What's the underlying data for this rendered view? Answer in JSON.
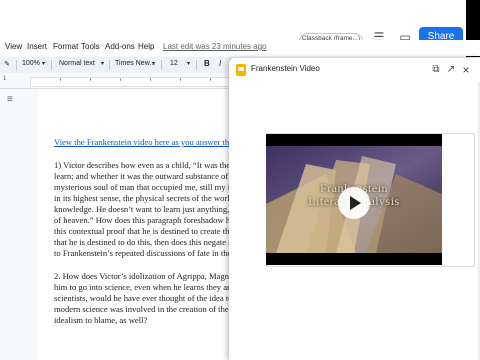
{
  "header": {
    "offline_status": "Classback (frame...)",
    "share_label": "Share"
  },
  "menu": {
    "items": [
      "View",
      "Insert",
      "Format",
      "Tools",
      "Add-ons",
      "Help"
    ],
    "last_edit": "Last edit was 23 minutes ago"
  },
  "toolbar": {
    "zoom": "100%",
    "style": "Normal text",
    "font": "Times New...",
    "size": "12",
    "bold": "B",
    "italic": "I"
  },
  "ruler": {
    "start_number": "1"
  },
  "document": {
    "link_text": "View the Frankenstein video here as you answer the foll",
    "question1": [
      "1) Victor describes how even as a child, “It was the secr",
      "learn; and whether it was the outward substance of thing",
      "mysterious soul of man that occupied me, still my inqui",
      "in its highest sense, the physical secrets of the world.” E",
      "knowledge. He doesn’t want to learn just anything, how",
      "of heaven.” How does this paragraph foreshadow him c",
      "this contextual proof that he is destined to create this me",
      "that he is destined to do this, then does this negate some",
      "to Frankenstein’s repeated discussions of fate in the nov"
    ],
    "question2": [
      "2. How does Victor’s idolization of Agrippa, Magnus, a",
      "him to go into science, even when he learns they are “sa",
      "scientists, would he have ever thought of the idea to cre",
      "modern science was involved in the creation of the mon",
      "idealism to blame, as well?"
    ]
  },
  "panel": {
    "title": "Frankenstein Video",
    "video": {
      "title_line1": "Frankenstein",
      "title_line2": "Literary Analysis"
    }
  },
  "icons": {
    "panel_logo": "slides-logo-icon",
    "open_new": "open-in-new-icon",
    "close": "close-icon",
    "copy": "copy-icon",
    "play": "play-icon"
  },
  "colors": {
    "accent": "#1a73e8",
    "link": "#1155cc",
    "slides_yellow": "#f4b400",
    "video_bg": "#5a4a78"
  }
}
